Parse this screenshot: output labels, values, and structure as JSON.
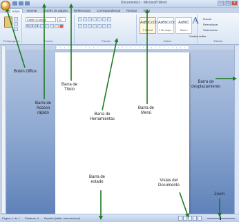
{
  "window": {
    "title": "Documento1 - Microsoft Word",
    "window_controls": [
      "-",
      "▢",
      "x"
    ]
  },
  "ribbon": {
    "tabs": [
      "Inicio",
      "Insertar",
      "Diseño de página",
      "Referencias",
      "Correspondencia",
      "Revisar",
      "Vista"
    ],
    "groups": [
      "Portapapeles",
      "Fuente",
      "Párrafo",
      "Estilos",
      "Edición"
    ],
    "font_name": "Calibri (Cuerpo)",
    "font_size": "11",
    "paste_label": "Pegar",
    "styles": [
      {
        "sample": "AaBbCcDc",
        "name": "¶ Normal"
      },
      {
        "sample": "AaBbCcDc",
        "name": "¶ Sin espa..."
      },
      {
        "sample": "AaBbC",
        "name": "Título 1"
      }
    ],
    "change_styles_label": "Cambiar estilos",
    "edit_items": [
      "Buscar",
      "Reemplazar",
      "Seleccionar"
    ]
  },
  "statusbar": {
    "page": "Página: 1 de 1",
    "words": "Palabras: 0",
    "language": "Español (alfab. internacional)"
  },
  "callouts": {
    "office_button": "Botón Office",
    "title_bar": "Barra de\nTítulo",
    "quick_access": "Barra de\nAcceso\nrápido",
    "toolbar": "Barra de\nHerramientas",
    "menu_bar": "Barra de\nMenú",
    "scroll_bar": "Barra de\ndesplazamiento",
    "status_bar": "Barra de\nestado",
    "document_views": "Vistas del\nDocumento",
    "zoom": "Zoom"
  },
  "colors": {
    "arrow": "#1f7a1f",
    "office_button": "#f2b64a",
    "workspace": "#8ea8d1"
  }
}
